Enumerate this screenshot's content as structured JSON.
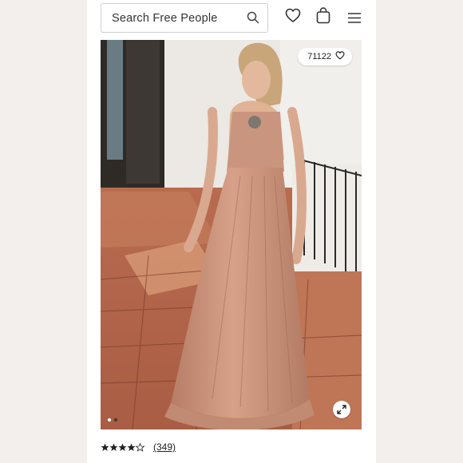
{
  "header": {
    "search_placeholder": "Search Free People",
    "icons": [
      "search-icon",
      "heart-icon",
      "bag-icon",
      "menu-icon"
    ]
  },
  "product": {
    "likes": "71122",
    "rating": 4.5,
    "review_count": "(349)",
    "image_count": 2,
    "active_image": 1
  },
  "colors": {
    "background": "#f3efec",
    "dress": "#c98f76",
    "text": "#222222"
  }
}
